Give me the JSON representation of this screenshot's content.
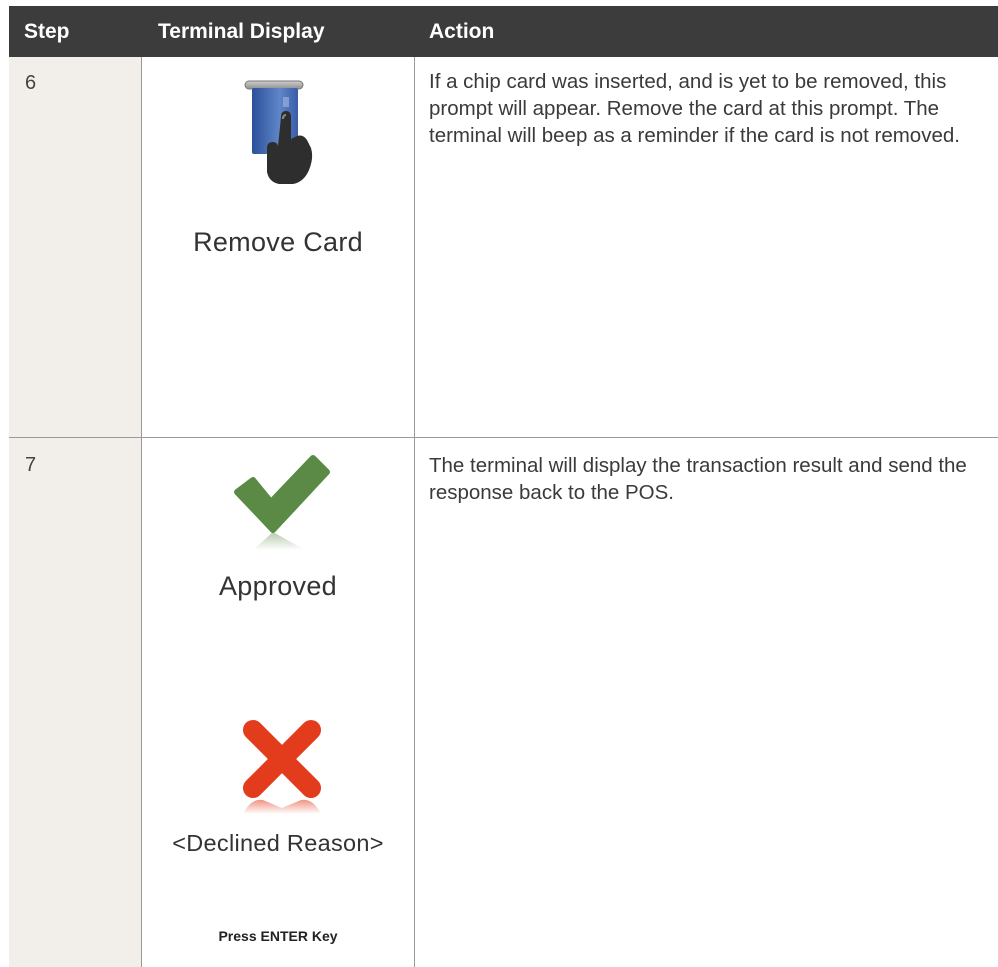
{
  "header": {
    "step": "Step",
    "terminal_display": "Terminal Display",
    "action": "Action"
  },
  "rows": [
    {
      "step": "6",
      "display_icon": "remove-card-icon",
      "display_label": "Remove Card",
      "action": "If a chip card was inserted, and is yet to be removed, this prompt will appear. Remove the card at this prompt. The terminal will beep as a reminder if the card is not removed."
    },
    {
      "step": "7",
      "approved_icon": "checkmark-icon",
      "approved_label": "Approved",
      "declined_icon": "x-mark-icon",
      "declined_label": "<Declined Reason>",
      "footer_label": "Press ENTER Key",
      "action": "The terminal will display the transaction result and send the response back to the POS."
    }
  ],
  "colors": {
    "header_bg": "#3c3c3c",
    "step_column_bg": "#f2efeb",
    "check_green": "#5a8a46",
    "x_red": "#e23c1c",
    "card_blue": "#3f66b0"
  }
}
